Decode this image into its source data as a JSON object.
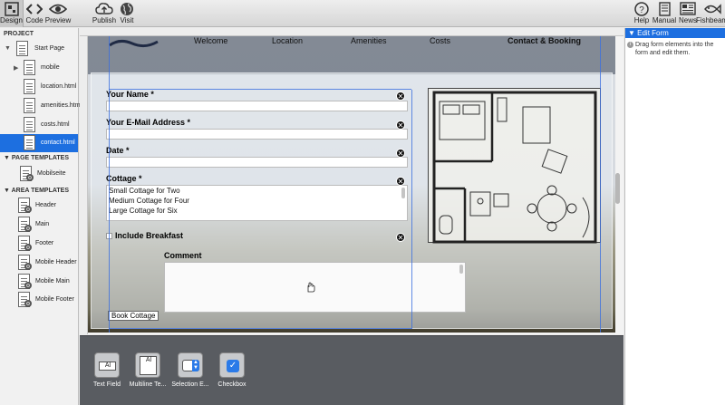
{
  "toolbar": {
    "left": [
      {
        "label": "Design",
        "icon": "design-icon"
      },
      {
        "label": "Code",
        "icon": "code-icon"
      },
      {
        "label": "Preview",
        "icon": "preview-icon"
      },
      {
        "label": "Publish",
        "icon": "publish-icon"
      },
      {
        "label": "Visit",
        "icon": "globe-icon"
      }
    ],
    "right": [
      {
        "label": "Help",
        "icon": "help-icon"
      },
      {
        "label": "Manual",
        "icon": "manual-icon"
      },
      {
        "label": "News",
        "icon": "news-icon"
      },
      {
        "label": "Fishbeam",
        "icon": "fishbeam-icon"
      }
    ]
  },
  "sidebar": {
    "project_header": "PROJECT",
    "pages": [
      {
        "label": "Start Page"
      },
      {
        "label": "mobile"
      },
      {
        "label": "location.html"
      },
      {
        "label": "amenities.html"
      },
      {
        "label": "costs.html"
      },
      {
        "label": "contact.html"
      }
    ],
    "page_templates_header": "PAGE TEMPLATES",
    "page_templates": [
      {
        "label": "Mobilseite"
      }
    ],
    "area_templates_header": "AREA TEMPLATES",
    "area_templates": [
      {
        "label": "Header"
      },
      {
        "label": "Main"
      },
      {
        "label": "Footer"
      },
      {
        "label": "Mobile Header"
      },
      {
        "label": "Mobile Main"
      },
      {
        "label": "Mobile Footer"
      }
    ]
  },
  "nav": {
    "items": [
      "Welcome",
      "Location",
      "Amenities",
      "Costs",
      "Contact & Booking"
    ]
  },
  "form": {
    "name_label": "Your Name *",
    "email_label": "Your E-Mail Address *",
    "date_label": "Date *",
    "cottage_label": "Cottage *",
    "cottage_options": [
      "Small Cottage for Two",
      "Medium Cottage for Four",
      "Large Cottage for Six"
    ],
    "breakfast_label": "Include Breakfast",
    "comment_label": "Comment",
    "submit_label": "Book Cottage"
  },
  "palette": {
    "items": [
      {
        "label": "Text Field",
        "glyph": "Al"
      },
      {
        "label": "Multiline Te...",
        "glyph": "Al"
      },
      {
        "label": "Selection E...",
        "glyph": ""
      },
      {
        "label": "Checkbox",
        "glyph": ""
      }
    ]
  },
  "rpanel": {
    "title": "Edit Form",
    "info": "Drag form elements into the form and edit them."
  },
  "colors": {
    "accent": "#1d6fe0",
    "guide": "#3b6fe0",
    "palette_bg": "#595c61"
  }
}
